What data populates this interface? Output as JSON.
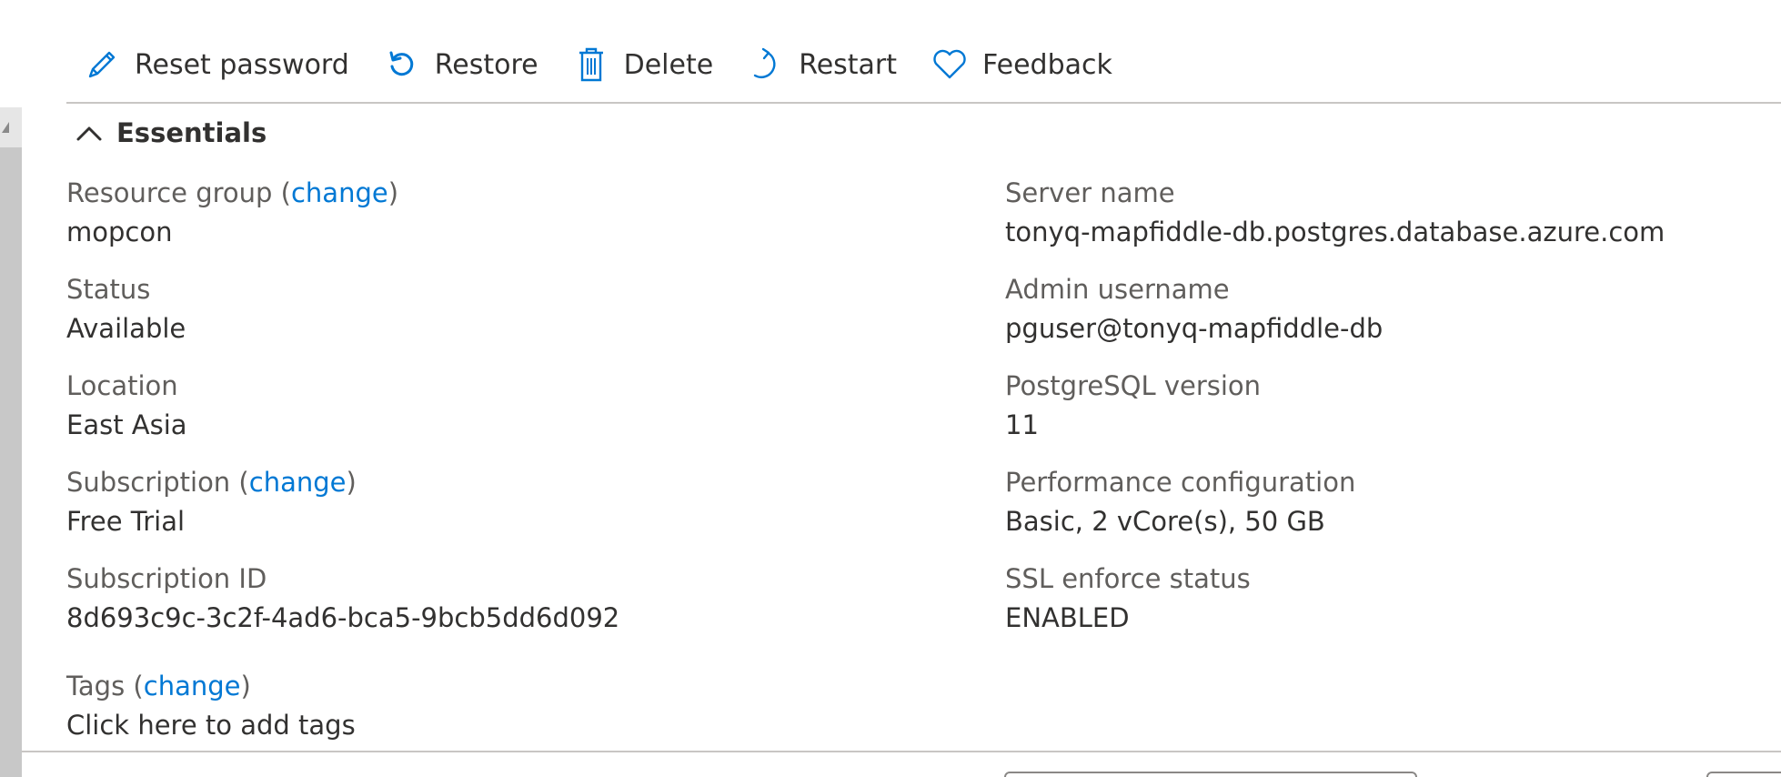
{
  "toolbar": {
    "reset_password": "Reset password",
    "restore": "Restore",
    "delete": "Delete",
    "restart": "Restart",
    "feedback": "Feedback"
  },
  "essentials": {
    "title": "Essentials"
  },
  "left": {
    "resource_group": {
      "label": "Resource group",
      "open_paren": "(",
      "change": "change",
      "close_paren": ")",
      "value": "mopcon"
    },
    "status": {
      "label": "Status",
      "value": "Available"
    },
    "location": {
      "label": "Location",
      "value": "East Asia"
    },
    "subscription": {
      "label": "Subscription",
      "open_paren": "(",
      "change": "change",
      "close_paren": ")",
      "value": "Free Trial"
    },
    "subscription_id": {
      "label": "Subscription ID",
      "value": "8d693c9c-3c2f-4ad6-bca5-9bcb5dd6d092"
    },
    "tags": {
      "label": "Tags",
      "open_paren": "(",
      "change": "change",
      "close_paren": ")",
      "value": "Click here to add tags"
    }
  },
  "right": {
    "server_name": {
      "label": "Server name",
      "value": "tonyq-mapfiddle-db.postgres.database.azure.com"
    },
    "admin_username": {
      "label": "Admin username",
      "value": "pguser@tonyq-mapfiddle-db"
    },
    "pg_version": {
      "label": "PostgreSQL version",
      "value": "11"
    },
    "performance": {
      "label": "Performance configuration",
      "value": "Basic, 2 vCore(s), 50 GB"
    },
    "ssl": {
      "label": "SSL enforce status",
      "value": "ENABLED"
    }
  },
  "colors": {
    "accent": "#0078d4",
    "text": "#323130",
    "label": "#605e5c",
    "divider": "#c8c6c4"
  },
  "icons": [
    "pencil-icon",
    "restore-icon",
    "trash-icon",
    "restart-icon",
    "heart-icon",
    "chevron-up-icon"
  ]
}
